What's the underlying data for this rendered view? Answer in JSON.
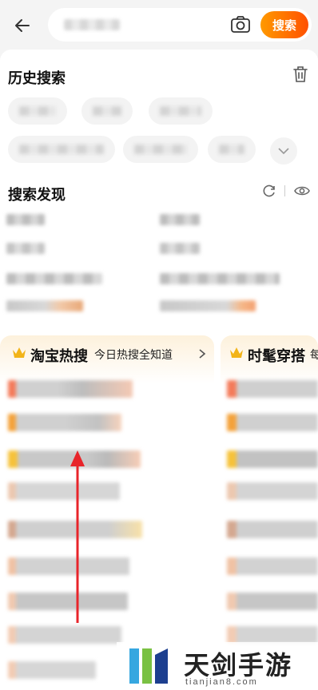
{
  "search": {
    "button_label": "搜索"
  },
  "history": {
    "title": "历史搜索"
  },
  "discover": {
    "title": "搜索发现"
  },
  "hot_cards": [
    {
      "title": "淘宝热搜",
      "subtitle": "今日热搜全知道"
    },
    {
      "title": "时髦穿搭",
      "subtitle": "每"
    }
  ],
  "watermark": {
    "text": "天剑手游网",
    "url": "tianjian8.com"
  },
  "colors": {
    "accent": "#ff5000",
    "accent_light": "#ff9a00",
    "annotation_arrow": "#e8242a"
  },
  "icons": [
    "back-arrow-icon",
    "camera-icon",
    "trash-icon",
    "chevron-down-icon",
    "refresh-icon",
    "eye-icon",
    "crown-icon",
    "chevron-right-icon"
  ]
}
